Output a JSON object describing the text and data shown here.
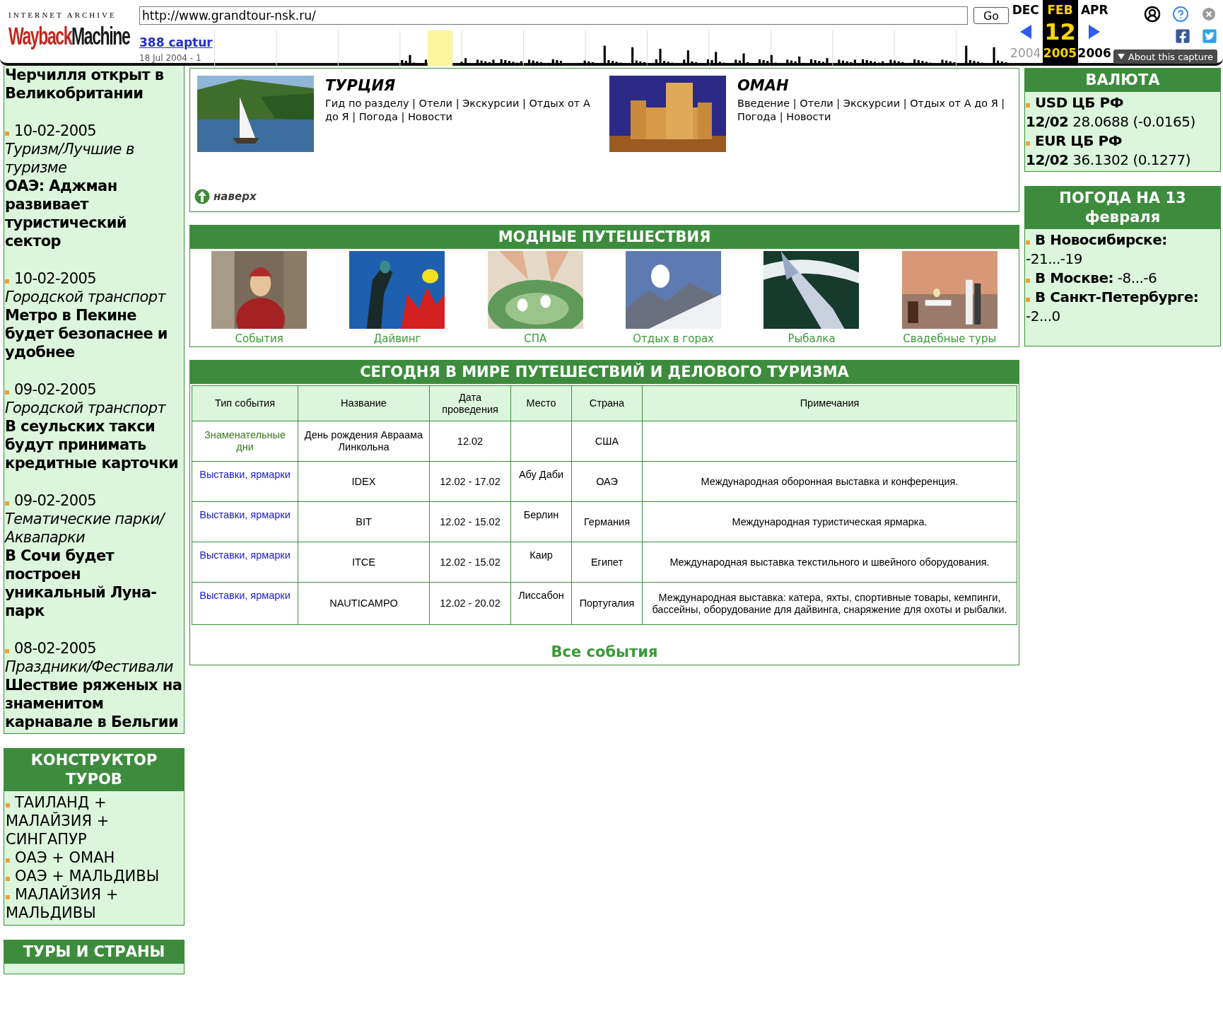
{
  "toolbar": {
    "archive_label": "INTERNET ARCHIVE",
    "logo_parts": [
      {
        "text": "Wayback",
        "kind": "accent"
      },
      {
        "text": "Machine",
        "kind": "plain"
      }
    ],
    "url": "http://www.grandtour-nsk.ru/",
    "go": "Go",
    "captures": "388 captur",
    "date_range": "18 Jul 2004 - 1",
    "months": [
      {
        "label": "DEC",
        "selected": false
      },
      {
        "label": "FEB",
        "selected": true
      },
      {
        "label": "APR",
        "selected": false
      }
    ],
    "day": "12",
    "years": [
      {
        "label": "2004",
        "selected": false,
        "disabled": true
      },
      {
        "label": "2005",
        "selected": true,
        "disabled": false
      },
      {
        "label": "2006",
        "selected": false,
        "disabled": false
      }
    ],
    "about": "About this capture"
  },
  "news": [
    {
      "headline": "Черчилля открыт в Великобритании"
    },
    {
      "date": "10-02-2005",
      "category": "Туризм/Лучшие в туризме",
      "headline": "ОАЭ: Аджман развивает туристический сектор"
    },
    {
      "date": "10-02-2005",
      "category": "Городской транспорт",
      "headline": "Метро в Пекине будет безопаснее и удобнее"
    },
    {
      "date": "09-02-2005",
      "category": "Городской транспорт",
      "headline": "В сеульских такси будут принимать кредитные карточки"
    },
    {
      "date": "09-02-2005",
      "category": "Тематические парки/ Аквапарки",
      "headline": "В Сочи будет построен уникальный Луна-парк"
    },
    {
      "date": "08-02-2005",
      "category": "Праздники/Фестивали",
      "headline": "Шествие ряженых на знаменитом карнавале в Бельгии"
    }
  ],
  "constructor": {
    "title": "КОНСТРУКТОР ТУРОВ",
    "items": [
      "ТАИЛАНД + МАЛАЙЗИЯ + СИНГАПУР",
      "ОАЭ + ОМАН",
      "ОАЭ + МАЛЬДИВЫ",
      "МАЛАЙЗИЯ + МАЛЬДИВЫ"
    ]
  },
  "tours": {
    "title": "ТУРЫ И СТРАНЫ"
  },
  "destinations": [
    {
      "title": "ТУРЦИЯ",
      "links": "Гид по разделу | Отели | Экскурсии | Отдых от А до Я | Погода | Новости"
    },
    {
      "title": "ОМАН",
      "links": "Введение | Отели | Экскурсии | Отдых от А до Я | Погода | Новости"
    }
  ],
  "top_link": "наверх",
  "fashion": {
    "title": "МОДНЫЕ ПУТЕШЕСТВИЯ",
    "items": [
      "События",
      "Дайвинг",
      "СПА",
      "Отдых в горах",
      "Рыбалка",
      "Свадебные туры"
    ]
  },
  "events": {
    "title": "СЕГОДНЯ В МИРЕ ПУТЕШЕСТВИЙ И ДЕЛОВОГО ТУРИЗМА",
    "columns": [
      "Тип события",
      "Название",
      "Дата проведения",
      "Место",
      "Страна",
      "Примечания"
    ],
    "rows": [
      {
        "type": "Знаменательные дни",
        "color": "#3a7a1e",
        "name": "День рождения Авраама Линкольна",
        "dates": "12.02",
        "country": "США"
      },
      {
        "type": "Выставки, ярмарки",
        "color": "#1a1ad0",
        "name": "IDEX",
        "dates": "12.02 - 17.02",
        "place": "Абу Даби",
        "country": "ОАЭ",
        "notes": "Международная оборонная выставка и конференция."
      },
      {
        "type": "Выставки, ярмарки",
        "color": "#1a1ad0",
        "name": "BIT",
        "dates": "12.02 - 15.02",
        "place": "Берлин",
        "country": "Германия",
        "notes": "Международная туристическая ярмарка."
      },
      {
        "type": "Выставки, ярмарки",
        "color": "#1a1ad0",
        "name": "ITCE",
        "dates": "12.02 - 15.02",
        "place": "Каир",
        "country": "Египет",
        "notes": "Международная выставка текстильного и швейного оборудования."
      },
      {
        "type": "Выставки, ярмарки",
        "color": "#1a1ad0",
        "name": "NAUTICAMPO",
        "dates": "12.02 - 20.02",
        "place": "Лиссабон",
        "country": "Португалия",
        "notes": "Международная выставка: катера, яхты, спортивные товары, кемпинги, бассейны, оборудование для дайвинга, снаряжение для охоты и рыбалки."
      }
    ],
    "all_link": "Все события"
  },
  "currency": {
    "title": "ВАЛЮТА",
    "items": [
      {
        "name": "USD ЦБ РФ",
        "date": "12/02",
        "rate": "28.0688 (-0.0165)"
      },
      {
        "name": "EUR ЦБ РФ",
        "date": "12/02",
        "rate": "36.1302 (0.1277)"
      }
    ]
  },
  "weather": {
    "title": "ПОГОДА НА 13 февраля",
    "items": [
      {
        "city": "В Новосибирске:",
        "value": "-21...-19"
      },
      {
        "city": "В Москве:",
        "value": "-8...-6"
      },
      {
        "city": "В Санкт-Петербурге:",
        "value": "-2...0"
      }
    ]
  }
}
